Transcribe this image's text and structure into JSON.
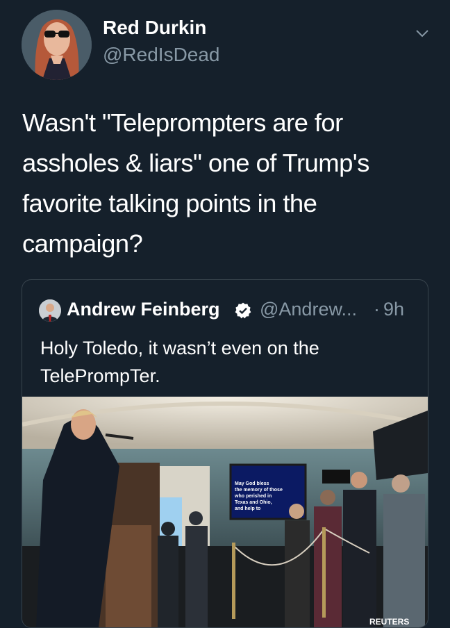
{
  "tweet": {
    "author_name": "Red Durkin",
    "author_handle": "@RedIsDead",
    "text": "Wasn't \"Teleprompters are for\nassholes & liars\" one of Trump's\nfavorite talking points in the\ncampaign?"
  },
  "quoted_tweet": {
    "author_name": "Andrew Feinberg",
    "author_handle": "@Andrew...",
    "separator": "·",
    "time": "9h",
    "text": "Holy Toledo, it wasn’t even on the TelePrompTer.",
    "photo": {
      "teleprompter_lines": [
        "May God bless",
        "the memory of those",
        "who perished in",
        "Texas and Ohio,",
        "and help to"
      ],
      "watermark": "REUTERS"
    }
  },
  "colors": {
    "background": "#15202b",
    "secondary_text": "#8899a6",
    "border": "#38444d",
    "verified_badge": "#ffffff"
  },
  "icons": [
    "chevron-down-icon",
    "verified-icon"
  ]
}
